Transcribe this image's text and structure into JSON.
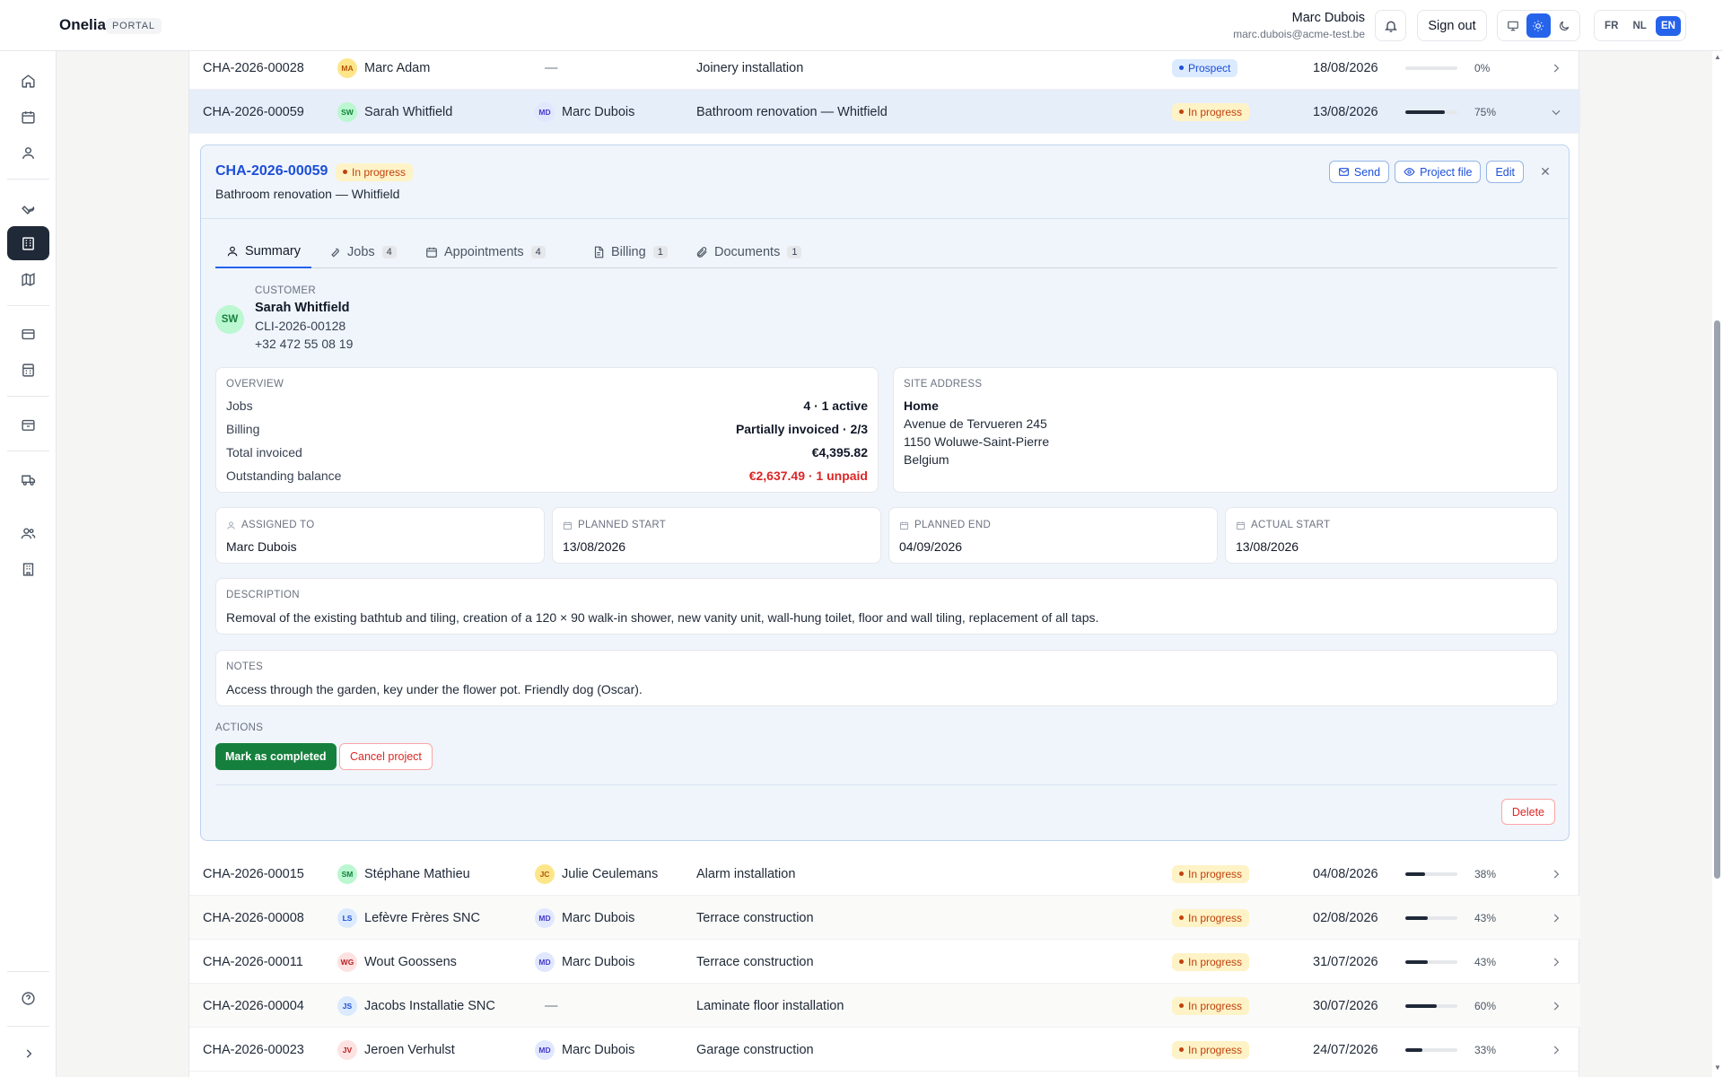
{
  "app": {
    "brand": "Onelia",
    "portal_badge": "PORTAL"
  },
  "user": {
    "name": "Marc Dubois",
    "email": "marc.dubois@acme-test.be"
  },
  "header": {
    "sign_out": "Sign out",
    "languages": [
      "FR",
      "NL",
      "EN"
    ],
    "active_language": "EN",
    "theme": "light"
  },
  "sidebar": {
    "icons": [
      "home-icon",
      "calendar-icon",
      "person-icon",
      "wrench-icon",
      "building-icon",
      "map-icon",
      "credit-card-icon",
      "calculator-icon",
      "archive-icon",
      "truck-icon",
      "users-icon",
      "office-building-icon",
      "help-icon",
      "chevron-right-icon"
    ],
    "active": "building-icon"
  },
  "rows_top": [
    {
      "ref": "CHA-2026-00028",
      "customer": "Marc Adam",
      "customer_initials": "MA",
      "assigned": "—",
      "title": "Joinery installation",
      "status": "Prospect",
      "date": "18/08/2026",
      "progress": 0,
      "progress_label": "0%"
    },
    {
      "ref": "CHA-2026-00059",
      "customer": "Sarah Whitfield",
      "customer_initials": "SW",
      "assigned": "Marc Dubois",
      "assigned_initials": "MD",
      "title": "Bathroom renovation — Whitfield",
      "status": "In progress",
      "date": "13/08/2026",
      "progress": 75,
      "progress_label": "75%"
    }
  ],
  "detail": {
    "ref": "CHA-2026-00059",
    "status": "In progress",
    "subtitle": "Bathroom renovation — Whitfield",
    "actions": {
      "send": "Send",
      "project_file": "Project file",
      "edit": "Edit"
    },
    "tabs": [
      {
        "label": "Summary",
        "count": ""
      },
      {
        "label": "Jobs",
        "count": "4"
      },
      {
        "label": "Appointments",
        "count": "4"
      },
      {
        "label": "Billing",
        "count": "1"
      },
      {
        "label": "Documents",
        "count": "1"
      }
    ],
    "customer": {
      "label": "CUSTOMER",
      "initials": "SW",
      "name": "Sarah Whitfield",
      "code": "CLI-2026-00128",
      "phone": "+32 472 55 08 19"
    },
    "overview": {
      "label": "OVERVIEW",
      "rows": [
        {
          "k": "Jobs",
          "v": "4 · 1 active"
        },
        {
          "k": "Billing",
          "v": "Partially invoiced · 2/3"
        },
        {
          "k": "Total invoiced",
          "v": "€4,395.82"
        },
        {
          "k": "Outstanding balance",
          "v": "€2,637.49 · 1 unpaid"
        }
      ]
    },
    "site_address": {
      "label": "SITE ADDRESS",
      "name": "Home",
      "line1": "Avenue de Tervueren 245",
      "line2": "1150 Woluwe-Saint-Pierre",
      "line3": "Belgium"
    },
    "assigned_to": {
      "label": "ASSIGNED TO",
      "value": "Marc Dubois"
    },
    "planned_start": {
      "label": "PLANNED START",
      "value": "13/08/2026"
    },
    "planned_end": {
      "label": "PLANNED END",
      "value": "04/09/2026"
    },
    "actual_start": {
      "label": "ACTUAL START",
      "value": "13/08/2026"
    },
    "description": {
      "label": "DESCRIPTION",
      "value": "Removal of the existing bathtub and tiling, creation of a 120 × 90 walk-in shower, new vanity unit, wall-hung toilet, floor and wall tiling, replacement of all taps."
    },
    "notes": {
      "label": "NOTES",
      "value": "Access through the garden, key under the flower pot. Friendly dog (Oscar)."
    },
    "actions_label": "ACTIONS",
    "mark_completed": "Mark as completed",
    "cancel_project": "Cancel project",
    "delete": "Delete"
  },
  "rows_bottom": [
    {
      "ref": "CHA-2026-00015",
      "customer": "Stéphane Mathieu",
      "customer_initials": "SM",
      "assigned": "Julie Ceulemans",
      "assigned_initials": "JC",
      "title": "Alarm installation",
      "status": "In progress",
      "date": "04/08/2026",
      "progress": 38,
      "progress_label": "38%"
    },
    {
      "ref": "CHA-2026-00008",
      "customer": "Lefèvre Frères SNC",
      "customer_initials": "LS",
      "assigned": "Marc Dubois",
      "assigned_initials": "MD",
      "title": "Terrace construction",
      "status": "In progress",
      "date": "02/08/2026",
      "progress": 43,
      "progress_label": "43%"
    },
    {
      "ref": "CHA-2026-00011",
      "customer": "Wout Goossens",
      "customer_initials": "WG",
      "assigned": "Marc Dubois",
      "assigned_initials": "MD",
      "title": "Terrace construction",
      "status": "In progress",
      "date": "31/07/2026",
      "progress": 43,
      "progress_label": "43%"
    },
    {
      "ref": "CHA-2026-00004",
      "customer": "Jacobs Installatie SNC",
      "customer_initials": "JS",
      "assigned": "—",
      "title": "Laminate floor installation",
      "status": "In progress",
      "date": "30/07/2026",
      "progress": 60,
      "progress_label": "60%"
    },
    {
      "ref": "CHA-2026-00023",
      "customer": "Jeroen Verhulst",
      "customer_initials": "JV",
      "assigned": "Marc Dubois",
      "assigned_initials": "MD",
      "title": "Garage construction",
      "status": "In progress",
      "date": "24/07/2026",
      "progress": 33,
      "progress_label": "33%"
    }
  ]
}
